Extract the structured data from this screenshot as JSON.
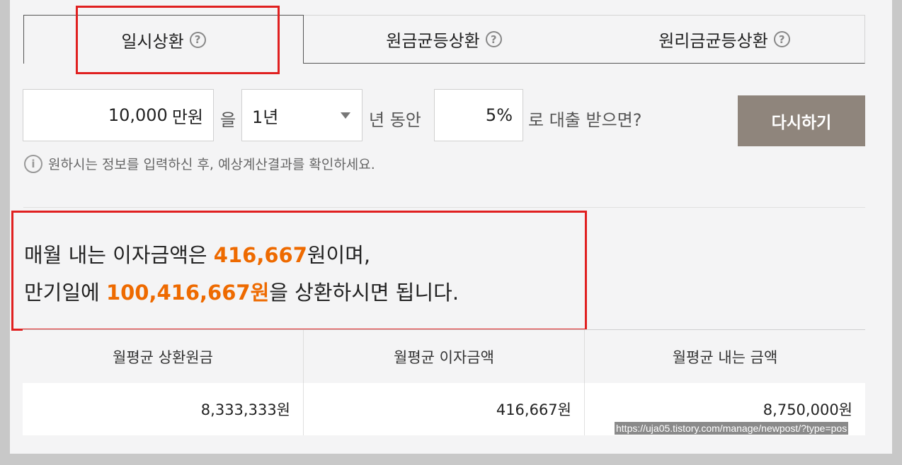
{
  "tabs": [
    {
      "label": "일시상환",
      "help": "?"
    },
    {
      "label": "원금균등상환",
      "help": "?"
    },
    {
      "label": "원리금균등상환",
      "help": "?"
    }
  ],
  "form": {
    "amount_value": "10,000",
    "amount_unit": "만원",
    "particle1": "을",
    "period_value": "1년",
    "particle2": "년 동안",
    "rate_value": "5%",
    "suffix": "로 대출 받으면?",
    "reset_label": "다시하기"
  },
  "hint": {
    "icon": "i",
    "text": "원하시는 정보를 입력하신 후, 예상계산결과를 확인하세요."
  },
  "result": {
    "line1_prefix": "매월 내는 이자금액은 ",
    "line1_amount": "416,667",
    "line1_suffix": "원이며,",
    "line2_prefix": "만기일에 ",
    "line2_amount": "100,416,667원",
    "line2_suffix": "을 상환하시면 됩니다."
  },
  "table": {
    "headers": [
      "월평균 상환원금",
      "월평균 이자금액",
      "월평균 내는 금액"
    ],
    "values": [
      "8,333,333원",
      "416,667원",
      "8,750,000원"
    ]
  },
  "watermark_url": "https://uja05.tistory.com/manage/newpost/?type=pos",
  "colors": {
    "highlight": "#ee6a00",
    "reset_button": "#8f857c",
    "annotation_box": "#e02020"
  }
}
